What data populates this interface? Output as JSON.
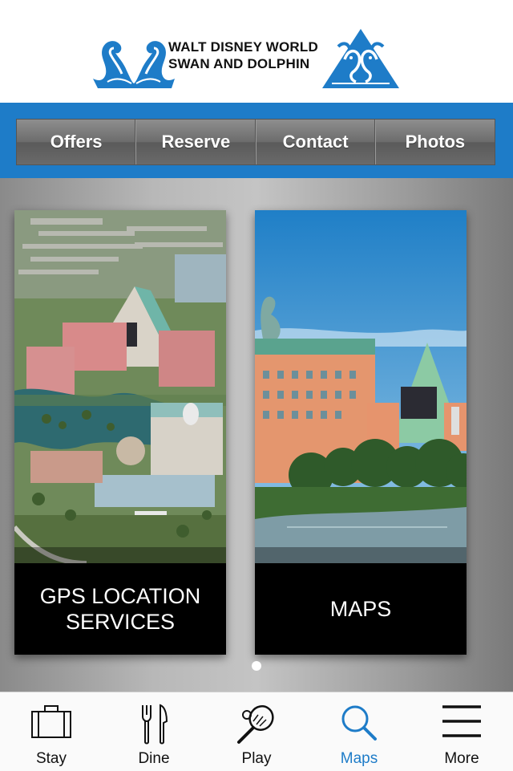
{
  "header": {
    "logo_line1": "WALT DISNEY WORLD",
    "logo_line2": "SWAN AND DOLPHIN"
  },
  "topnav": {
    "items": [
      {
        "label": "Offers"
      },
      {
        "label": "Reserve"
      },
      {
        "label": "Contact"
      },
      {
        "label": "Photos"
      }
    ]
  },
  "cards": [
    {
      "caption_line1": "GPS LOCATION",
      "caption_line2": "SERVICES",
      "image": "aerial-resort-photo"
    },
    {
      "caption": "MAPS",
      "image": "hotel-lagoon-photo"
    }
  ],
  "pager": {
    "pages": 1,
    "current": 1
  },
  "tabbar": {
    "items": [
      {
        "label": "Stay",
        "icon": "suitcase-icon"
      },
      {
        "label": "Dine",
        "icon": "fork-knife-icon"
      },
      {
        "label": "Play",
        "icon": "tennis-racket-icon"
      },
      {
        "label": "Maps",
        "icon": "search-icon",
        "active": true
      },
      {
        "label": "More",
        "icon": "menu-icon"
      }
    ]
  },
  "colors": {
    "brand_blue": "#1e7cc8",
    "nav_gray": "#6c6c6c",
    "caption_bg": "#000000",
    "active_tab": "#1e7cc8"
  }
}
